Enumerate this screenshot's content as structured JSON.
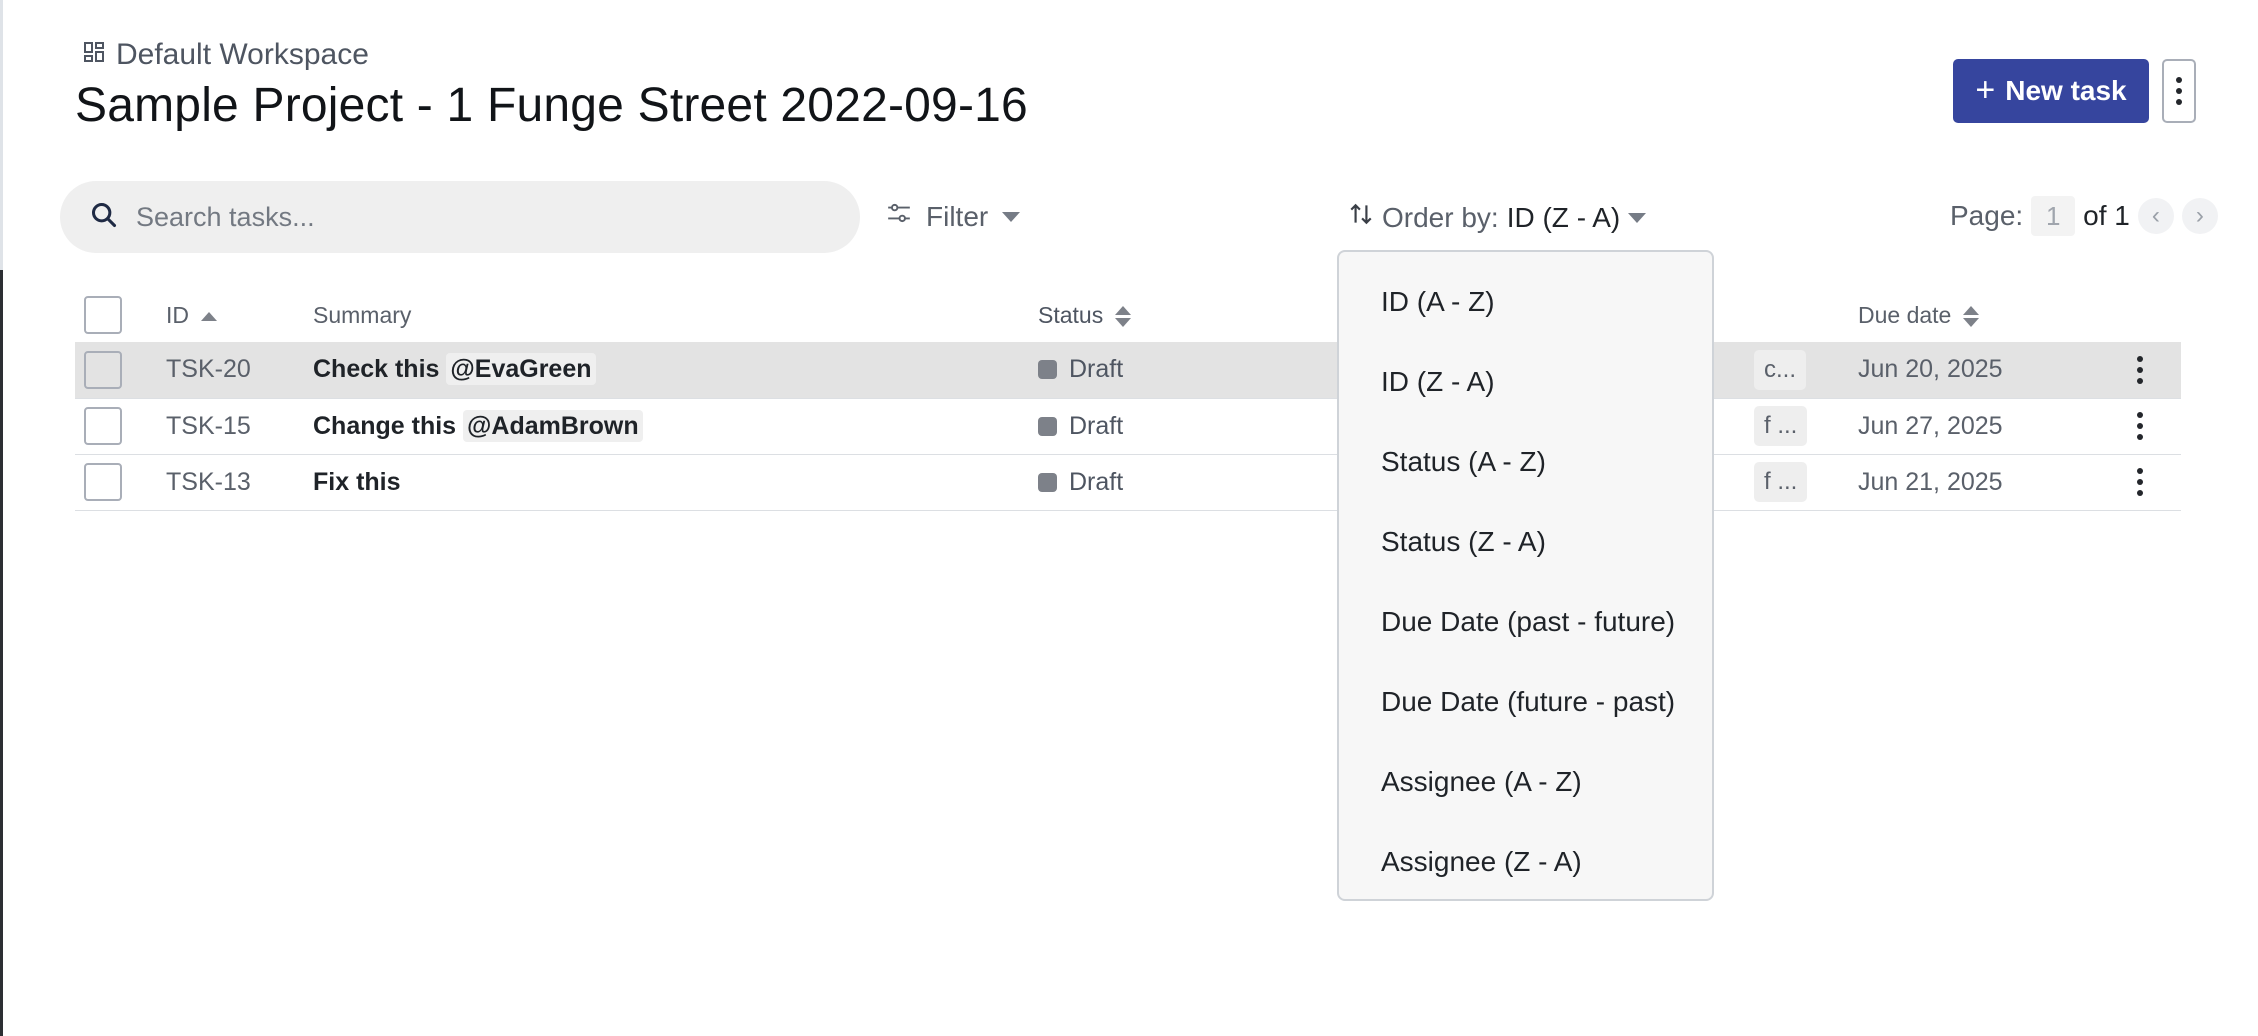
{
  "breadcrumb": {
    "workspace": "Default Workspace",
    "icon": "dashboard-icon"
  },
  "page_title": "Sample Project - 1 Funge Street 2022-09-16",
  "toolbar": {
    "new_task_label": "New task",
    "search_placeholder": "Search tasks...",
    "filter_label": "Filter",
    "order_prefix": "Order by:",
    "order_value": "ID (Z - A)",
    "page_label": "Page:",
    "page_number": "1",
    "page_of": "of 1"
  },
  "table": {
    "headers": {
      "id": "ID",
      "summary": "Summary",
      "status": "Status",
      "due": "Due date"
    },
    "rows": [
      {
        "id": "TSK-20",
        "summary": "Check this",
        "mention": "@EvaGreen",
        "status": "Draft",
        "chip": "c...",
        "due": "Jun 20, 2025"
      },
      {
        "id": "TSK-15",
        "summary": "Change this",
        "mention": "@AdamBrown",
        "status": "Draft",
        "chip": "f ...",
        "due": "Jun 27, 2025"
      },
      {
        "id": "TSK-13",
        "summary": "Fix this",
        "mention": "",
        "status": "Draft",
        "chip": "f ...",
        "due": "Jun 21, 2025"
      }
    ]
  },
  "order_menu": {
    "items": [
      "ID (A - Z)",
      "ID (Z - A)",
      "Status (A - Z)",
      "Status (Z - A)",
      "Due Date (past - future)",
      "Due Date (future - past)",
      "Assignee (A - Z)",
      "Assignee (Z - A)"
    ]
  },
  "colors": {
    "primary": "#36459e",
    "status_draft": "#7d8189",
    "row_highlight": "#e3e3e3"
  }
}
